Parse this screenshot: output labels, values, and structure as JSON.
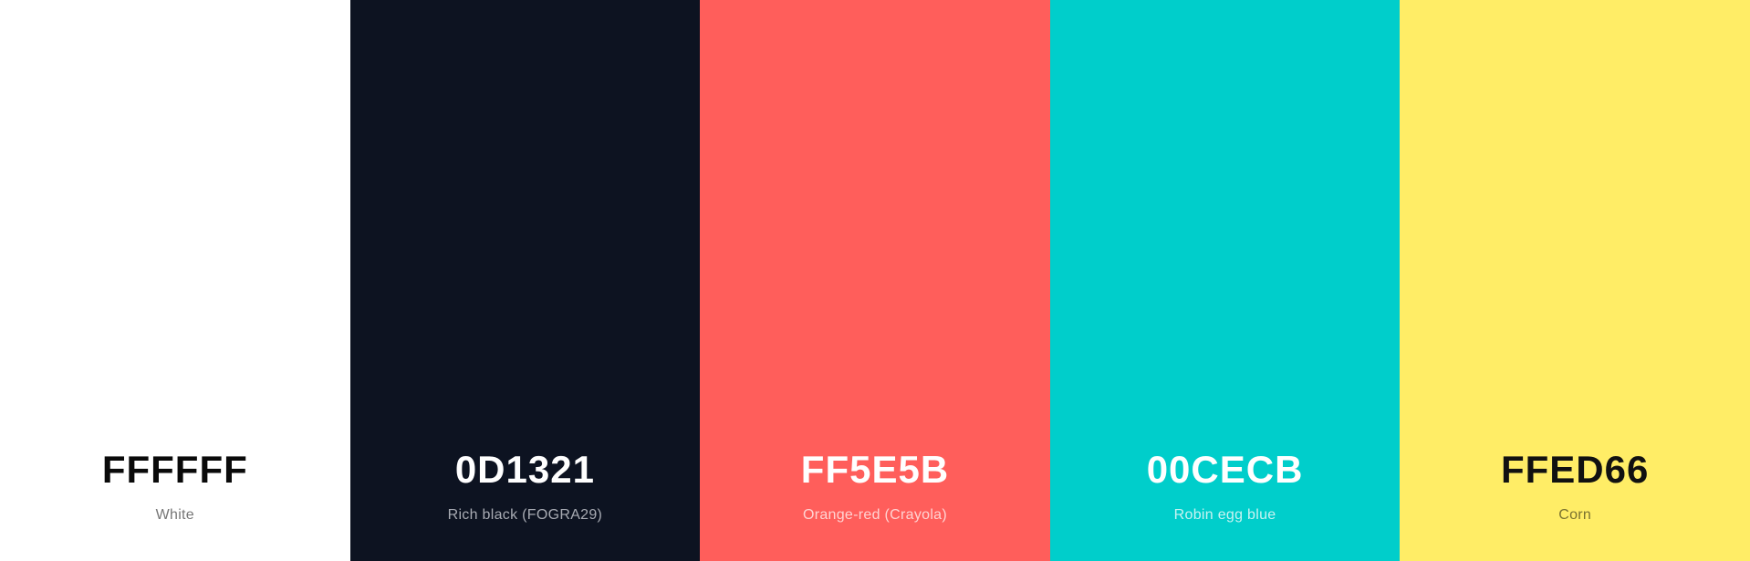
{
  "palette": {
    "colors": [
      {
        "hex": "FFFFFF",
        "name": "White",
        "background": "#FFFFFF",
        "hex_color": "#0a0a0a",
        "name_color": "#777777"
      },
      {
        "hex": "0D1321",
        "name": "Rich black (FOGRA29)",
        "background": "#0D1321",
        "hex_color": "#ffffff",
        "name_color": "#a8abb3"
      },
      {
        "hex": "FF5E5B",
        "name": "Orange-red (Crayola)",
        "background": "#FF5E5B",
        "hex_color": "#ffffff",
        "name_color": "#ffd3d2"
      },
      {
        "hex": "00CECB",
        "name": "Robin egg blue",
        "background": "#00CECB",
        "hex_color": "#ffffff",
        "name_color": "#c8f3f2"
      },
      {
        "hex": "FFED66",
        "name": "Corn",
        "background": "#FFED66",
        "hex_color": "#111111",
        "name_color": "#7a7230"
      }
    ]
  }
}
